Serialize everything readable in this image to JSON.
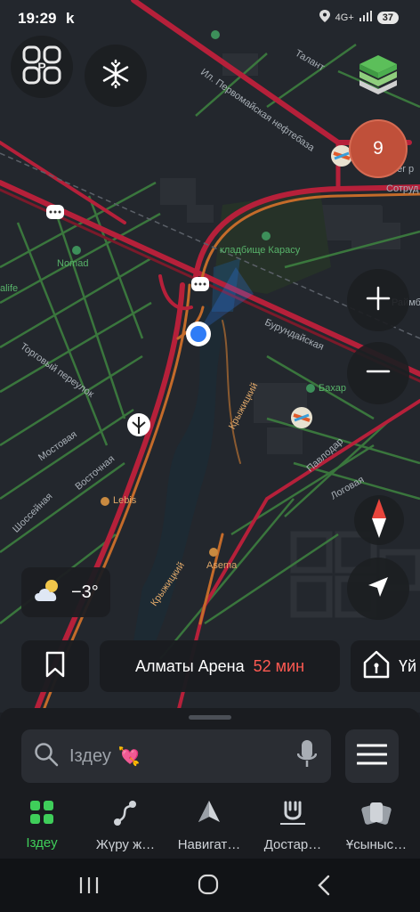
{
  "status_bar": {
    "time": "19:29",
    "extra": "k",
    "network": "4G+",
    "battery": "37"
  },
  "map": {
    "labels": {
      "street_pervomayskaya": "Ил. Первомайская нефтебаза",
      "street_talant": "Талант",
      "cemetery": "кладбище Карасу",
      "nomad": "Nomad",
      "alife": "alife",
      "street_burundayskaya": "Бурундайская",
      "bakhar": "Бахар",
      "street_kryzhitskiy": "Крыжицкий",
      "street_torgovaya": "Торговый переулок",
      "street_mostovaya": "Мостовая",
      "street_vostochnaya": "Восточная",
      "lebis": "Lebis",
      "street_shosseynaya": "Шоссейная",
      "street_pavlodar": "Павлодар",
      "street_logovaya": "Логовая",
      "asema": "Asema",
      "street_kryzhitskiy2": "Крыжицкий",
      "sotrud": "Сотруд",
      "raimb": "Раймб",
      "bashnier": "ner p"
    },
    "traffic_badge": "9",
    "zoom_in": "+",
    "zoom_out": "−"
  },
  "weather": {
    "icon": "cloud-sun-icon",
    "temperature": "−3°"
  },
  "route": {
    "destination": "Алматы Арена",
    "eta": "52 мин"
  },
  "home": {
    "label": "Үй"
  },
  "search": {
    "placeholder": "Іздеу",
    "emoji": "💘"
  },
  "tabs": [
    {
      "label": "Іздеу",
      "icon": "grid-icon",
      "active": true
    },
    {
      "label": "Жүру ж…",
      "icon": "route-icon",
      "active": false
    },
    {
      "label": "Навигат…",
      "icon": "navigator-icon",
      "active": false
    },
    {
      "label": "Достар…",
      "icon": "friends-icon",
      "active": false
    },
    {
      "label": "Ұсыныс…",
      "icon": "cards-icon",
      "active": false
    }
  ],
  "colors": {
    "accent": "#3fce5a",
    "eta": "#ff5a52",
    "traffic_badge": "#c0503a",
    "location": "#2f7cf6"
  }
}
